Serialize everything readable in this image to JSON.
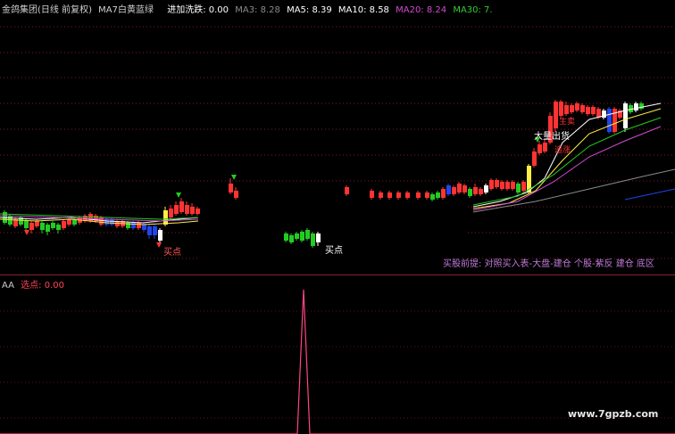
{
  "header": {
    "stock_name": "金鸽集团(日线 前复权)",
    "indicator": "MA7白黄蓝绿",
    "wash_label": "进加洗跌: 0.00",
    "ma3": "MA3: 8.28",
    "ma5": "MA5: 8.39",
    "ma10": "MA10: 8.58",
    "ma20": "MA20: 8.24",
    "ma30": "MA30: 7.",
    "colors": {
      "stock_name": "#d0d0d0",
      "wash": "#ffffff",
      "ma3": "#8a8a8a",
      "ma5": "#ffffff",
      "ma10": "#ffffff",
      "ma20": "#d04bd0",
      "ma30": "#33cc33"
    }
  },
  "annotations": {
    "buy_point_1": "买点",
    "buy_point_2": "买点",
    "big_sell": "大量出货",
    "top_mark": "主卖",
    "chase_mark": "追涨"
  },
  "note": "买股前提: 对照买入表-大盘-建仓  个股-紫反 建仓 底区",
  "sub_pane": {
    "label": "AA",
    "value_label": "选点: 0.00"
  },
  "watermark": "www.7gpzb.com"
}
